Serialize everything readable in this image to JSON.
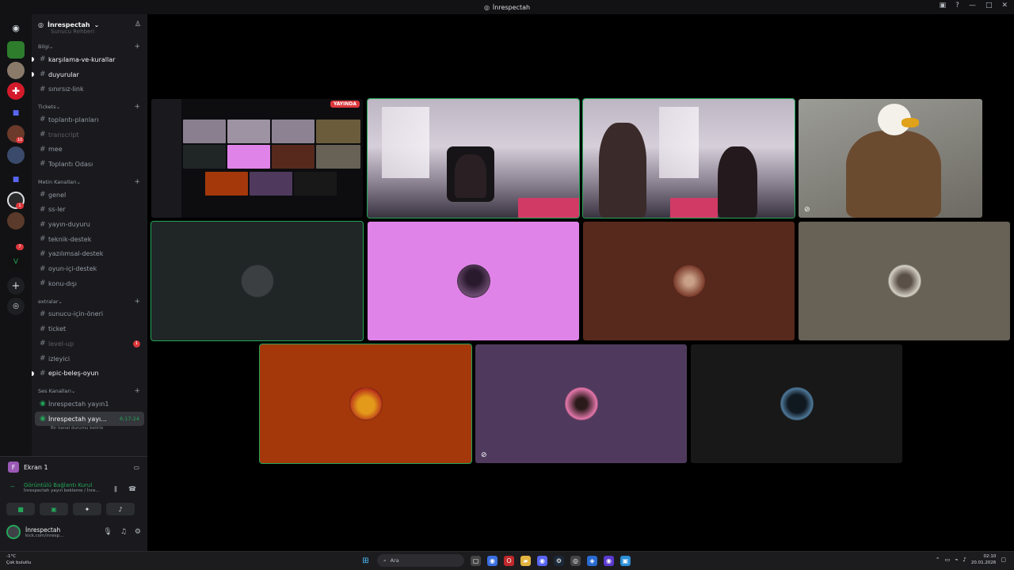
{
  "window": {
    "title": "İnrespectah"
  },
  "server": {
    "name": "İnrespectah",
    "faded_item": "Sunucu Rehberi"
  },
  "categories": [
    {
      "name": "Bilgi",
      "channels": [
        {
          "name": "karşılama-ve-kurallar",
          "state": "unread"
        },
        {
          "name": "duyurular",
          "state": "unread"
        },
        {
          "name": "sınırsız-link",
          "state": "normal"
        }
      ]
    },
    {
      "name": "Tickets",
      "channels": [
        {
          "name": "toplantı-planları",
          "state": "normal"
        },
        {
          "name": "transcript",
          "state": "muted"
        },
        {
          "name": "mee",
          "state": "normal"
        },
        {
          "name": "Toplantı Odası",
          "state": "normal"
        }
      ]
    },
    {
      "name": "Metin Kanalları",
      "channels": [
        {
          "name": "genel",
          "state": "normal"
        },
        {
          "name": "ss-ler",
          "state": "normal"
        },
        {
          "name": "yayın-duyuru",
          "state": "normal"
        },
        {
          "name": "teknik-destek",
          "state": "normal"
        },
        {
          "name": "yazılımsal-destek",
          "state": "normal"
        },
        {
          "name": "oyun-içi-destek",
          "state": "normal"
        },
        {
          "name": "konu-dışı",
          "state": "normal"
        }
      ]
    },
    {
      "name": "extralar",
      "channels": [
        {
          "name": "sunucu-için-öneri",
          "state": "normal"
        },
        {
          "name": "ticket",
          "state": "normal"
        },
        {
          "name": "level-up",
          "state": "muted",
          "badge": "1"
        },
        {
          "name": "izleyici",
          "state": "normal"
        },
        {
          "name": "epic-beleş-oyun",
          "state": "unread"
        }
      ]
    },
    {
      "name": "Ses Kanalları",
      "channels": []
    }
  ],
  "voice_channels": [
    {
      "name": "İnrespectah yayın1"
    },
    {
      "name": "İnrespectah yayı...",
      "time": "6:17:24",
      "status": "Bir kanal durumu belirle"
    }
  ],
  "stream_panel": {
    "screen_label": "Ekran 1",
    "screen_initial": "F",
    "connection": "Görüntülü Bağlantı Kurul",
    "connection_sub": "İnrespectah yayın bekleme / İnre...",
    "user": "İnrespectah",
    "user_status": "kick.com/inresp..."
  },
  "video": {
    "live_label": "YAYINDA"
  },
  "rail_badges": [
    "10",
    "1",
    "7"
  ],
  "taskbar": {
    "temperature": "-1°C",
    "weather": "Çok bulutlu",
    "search": "Ara",
    "time": "02:10",
    "date": "20.01.2026"
  },
  "colors": {
    "accent_green": "#23a559",
    "pink_tile": "#e083e8",
    "brown_tile": "#57291d",
    "grey_tile": "#676156",
    "orange_tile": "#a4380a",
    "purple_tile": "#4f3a5e",
    "dark_tile": "#202526"
  }
}
